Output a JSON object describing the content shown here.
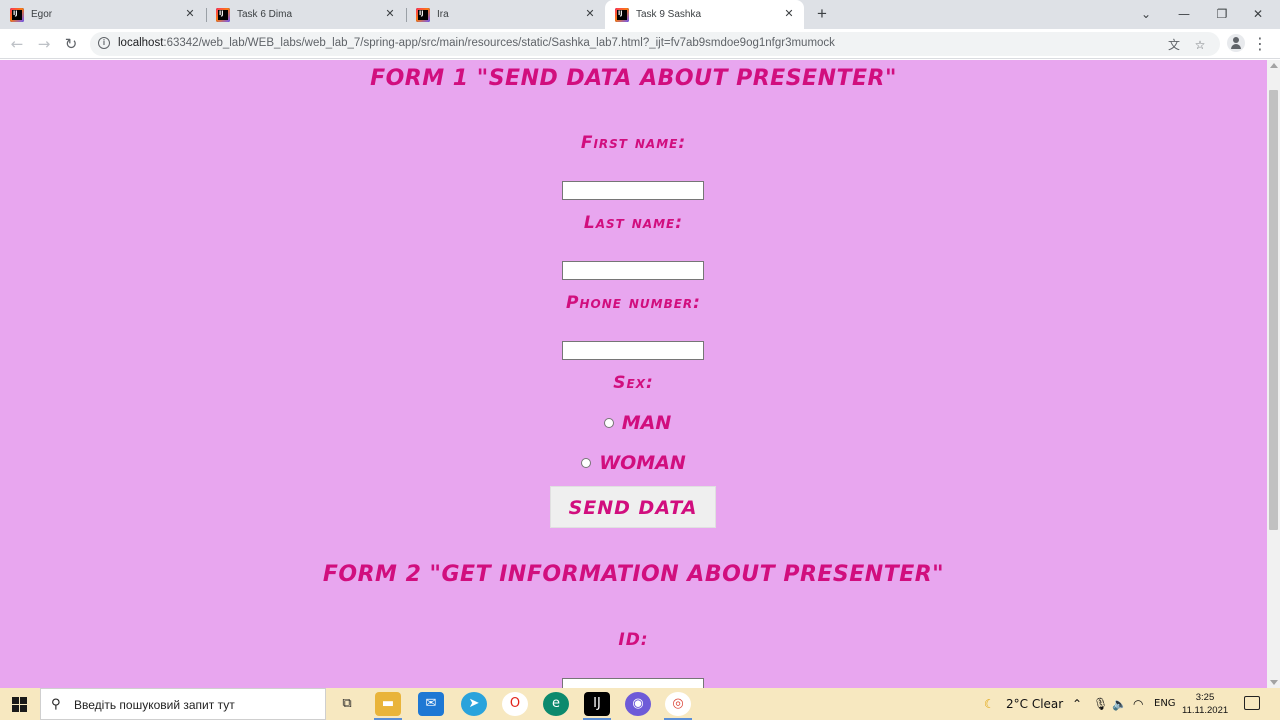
{
  "browser": {
    "tabs": [
      {
        "title": "Egor",
        "active": false
      },
      {
        "title": "Task 6 Dima",
        "active": false
      },
      {
        "title": "Ira",
        "active": false
      },
      {
        "title": "Task 9 Sashka",
        "active": true
      }
    ],
    "new_tab_label": "+",
    "url_host": "localhost",
    "url_rest": ":63342/web_lab/WEB_labs/web_lab_7/spring-app/src/main/resources/static/Sashka_lab7.html?_ijt=fv7ab9smdoe9og1nfgr3mumock"
  },
  "page": {
    "form1": {
      "title": "FORM 1 \"SEND DATA ABOUT PRESENTER\"",
      "first_name_label": "First name:",
      "first_name_value": "",
      "last_name_label": "Last name:",
      "last_name_value": "",
      "phone_label": "Phone number:",
      "phone_value": "",
      "sex_label": "Sex:",
      "sex_options": [
        "MAN",
        "WOMAN"
      ],
      "submit_label": "SEND DATA"
    },
    "form2": {
      "title": "FORM 2 \"GET INFORMATION ABOUT PRESENTER\"",
      "id_label": "ID:",
      "id_value": ""
    },
    "colors": {
      "background": "#e8a6ef",
      "text": "#d10e7e"
    }
  },
  "taskbar": {
    "search_placeholder": "Введіть пошуковий запит тут",
    "weather": "2°C  Clear",
    "language": "ENG",
    "time": "3:25",
    "date": "11.11.2021"
  }
}
